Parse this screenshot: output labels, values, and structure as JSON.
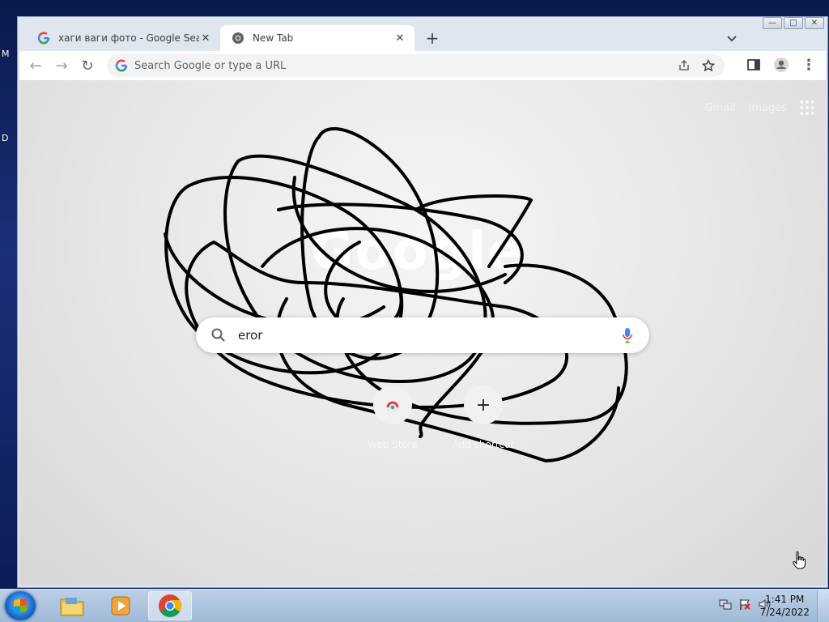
{
  "desktop": {
    "left_letters": [
      "M",
      "D"
    ]
  },
  "window": {
    "tabs": [
      {
        "title": "хаги ваги фото - Google Search",
        "active": false
      },
      {
        "title": "New Tab",
        "active": true
      }
    ],
    "tab_close_glyph": "✕",
    "new_tab_glyph": "+",
    "controls": {
      "minimize": "—",
      "maximize": "□",
      "close": "✕"
    }
  },
  "toolbar": {
    "back_glyph": "←",
    "forward_glyph": "→",
    "reload_glyph": "↻",
    "omnibox_placeholder": "Search Google or type a URL",
    "menu_glyph": "⋮"
  },
  "ntp": {
    "top_links": [
      "Gmail",
      "Images"
    ],
    "logo_text": "Google",
    "search_value": "eror",
    "shortcuts": [
      {
        "label": "Web Store"
      },
      {
        "label": "Add shortcut",
        "glyph": "+"
      }
    ]
  },
  "taskbar": {
    "clock_time": "1:41 PM",
    "clock_date": "7/24/2022"
  },
  "colors": {
    "chrome_accent": "#1a73e8",
    "tab_active_bg": "#ffffff",
    "taskbar": "#a9c3de"
  },
  "icons": [
    "google-g-icon",
    "chrome-icon",
    "search-icon",
    "mic-icon",
    "apps-grid-icon",
    "share-icon",
    "star-icon",
    "side-panel-icon",
    "profile-icon",
    "folder-icon",
    "media-player-icon",
    "network-icon",
    "flag-icon",
    "volume-icon"
  ]
}
